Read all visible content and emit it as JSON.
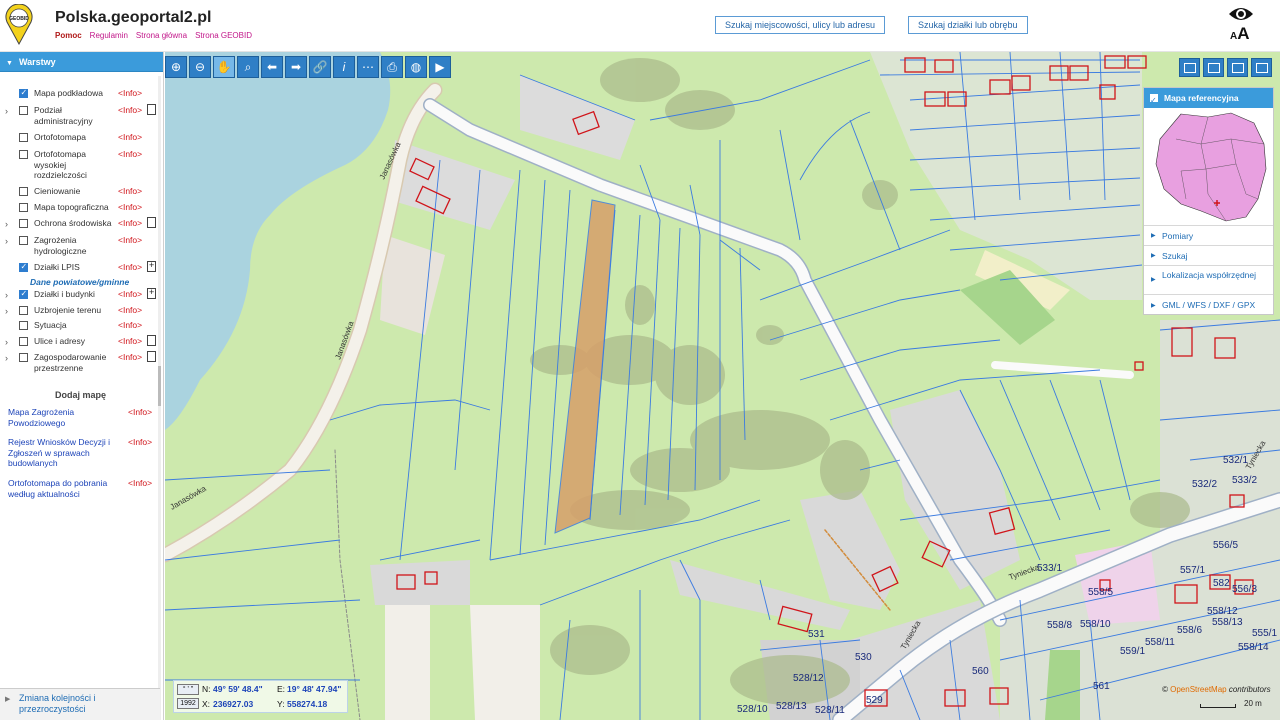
{
  "header": {
    "logo_text": "GEOBID",
    "title": "Polska.geoportal2.pl",
    "links": [
      "Pomoc",
      "Regulamin",
      "Strona główna",
      "Strona GEOBID"
    ],
    "search_place_button": "Szukaj miejscowości, ulicy lub adresu",
    "search_parcel_button": "Szukaj działki lub obrębu",
    "font_toggle_small": "A",
    "font_toggle_big": "A"
  },
  "sidebar": {
    "title": "Warstwy",
    "layers": [
      {
        "label": "Mapa podkładowa",
        "checked": true,
        "expander": false,
        "doc": "",
        "info": "<Info>"
      },
      {
        "label": "Podział administracyjny",
        "checked": false,
        "expander": true,
        "doc": "doc",
        "info": "<Info>"
      },
      {
        "label": "Ortofotomapa",
        "checked": false,
        "expander": false,
        "doc": "",
        "info": "<Info>"
      },
      {
        "label": "Ortofotomapa wysokiej rozdzielczości",
        "checked": false,
        "expander": false,
        "doc": "",
        "info": "<Info>"
      },
      {
        "label": "Cieniowanie",
        "checked": false,
        "expander": false,
        "doc": "",
        "info": "<Info>"
      },
      {
        "label": "Mapa topograficzna",
        "checked": false,
        "expander": false,
        "doc": "",
        "info": "<Info>"
      },
      {
        "label": "Ochrona środowiska",
        "checked": false,
        "expander": true,
        "doc": "doc",
        "info": "<Info>"
      },
      {
        "label": "Zagrożenia hydrologiczne",
        "checked": false,
        "expander": true,
        "doc": "",
        "info": "<Info>"
      },
      {
        "label": "Działki LPIS",
        "checked": true,
        "expander": false,
        "doc": "plus",
        "info": "<Info>"
      },
      {
        "label": "Działki i budynki",
        "checked": true,
        "expander": true,
        "doc": "plus",
        "info": "<Info>"
      },
      {
        "label": "Uzbrojenie terenu",
        "checked": false,
        "expander": true,
        "doc": "",
        "info": "<Info>"
      },
      {
        "label": "Sytuacja",
        "checked": false,
        "expander": false,
        "doc": "",
        "info": "<Info>"
      },
      {
        "label": "Ulice i adresy",
        "checked": false,
        "expander": true,
        "doc": "doc",
        "info": "<Info>"
      },
      {
        "label": "Zagospodarowanie przestrzenne",
        "checked": false,
        "expander": true,
        "doc": "doc",
        "info": "<Info>"
      }
    ],
    "subheader": "Dane powiatowe/gminne",
    "add_map_title": "Dodaj mapę",
    "add_maps": [
      {
        "label": "Mapa Zagrożenia Powodziowego",
        "info": "<Info>"
      },
      {
        "label": "Rejestr Wniosków Decyzji i Zgłoszeń w sprawach budowlanych",
        "info": "<Info>"
      },
      {
        "label": "Ortofotomapa do pobrania według aktualności",
        "info": "<Info>"
      }
    ],
    "footer": "Zmiana kolejności i przezroczystości"
  },
  "toolbar": {
    "buttons": [
      "zoom-in-icon",
      "zoom-out-icon",
      "pan-hand-icon",
      "zoom-box-icon",
      "back-arrow-icon",
      "forward-arrow-icon",
      "link-icon",
      "info-icon",
      "measure-icon",
      "print-icon",
      "globe-icon",
      "camera-icon"
    ],
    "active": "pan-hand-icon"
  },
  "right_panel": {
    "title": "Mapa referencyjna",
    "items": [
      "Pomiary",
      "Szukaj",
      "Lokalizacja współrzędnej",
      "GML / WFS / DXF / GPX"
    ]
  },
  "coordinates": {
    "badge1": "° ' \"",
    "badge2": "1992",
    "n_label": "N:",
    "n_value": "49° 59' 48.4\"",
    "e_label": "E:",
    "e_value": "19° 48' 47.94\"",
    "x_label": "X:",
    "x_value": "236927.03",
    "y_label": "Y:",
    "y_value": "558274.18"
  },
  "map": {
    "credit_prefix": "© ",
    "credit_link": "OpenStreetMap",
    "credit_suffix": " contributors",
    "scale": "20 m",
    "street_labels": [
      "Janasówka",
      "Janasówka",
      "Janasówka",
      "Tyniecka",
      "Tyniecka",
      "Tyniecka"
    ],
    "parcel_labels": [
      "530",
      "531",
      "533/1",
      "560",
      "561",
      "528/12",
      "528/13",
      "528/10",
      "528/11",
      "529",
      "558/5",
      "558/8",
      "558/10",
      "559/1",
      "558/6",
      "558/11",
      "558/12",
      "558/13",
      "558/14",
      "557/1",
      "556/5",
      "556/3",
      "532/1",
      "532/2",
      "533/2",
      "582",
      "555/1"
    ],
    "colors": {
      "land": "#cde9ad",
      "water": "#aad3df",
      "parcel_line": "#3b7be0",
      "road": "#ffffff",
      "highlight": "#d6a06a",
      "building": "#d9d0c9"
    }
  }
}
